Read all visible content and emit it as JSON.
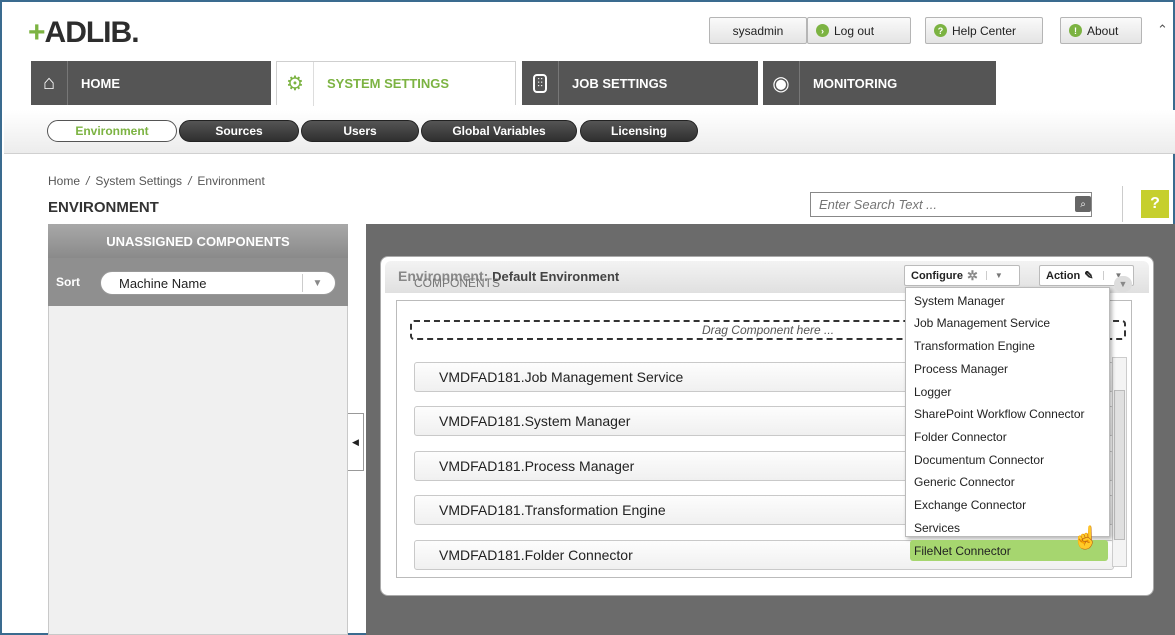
{
  "brand": {
    "logo_text": "ADLIB",
    "logo_mark": "+"
  },
  "topbar": {
    "user": "sysadmin",
    "logout_label": "Log out",
    "help_label": "Help Center",
    "about_label": "About"
  },
  "nav": {
    "home": "HOME",
    "system_settings": "SYSTEM SETTINGS",
    "job_settings": "JOB SETTINGS",
    "monitoring": "MONITORING"
  },
  "subnav": [
    "Environment",
    "Sources",
    "Users",
    "Global Variables",
    "Licensing"
  ],
  "breadcrumb": {
    "home": "Home",
    "sep": "/",
    "system_settings": "System Settings",
    "current": "Environment"
  },
  "page_title": "ENVIRONMENT",
  "search": {
    "placeholder": "Enter Search Text ..."
  },
  "help_mark": "?",
  "left_panel": {
    "title": "UNASSIGNED COMPONENTS",
    "sort_label": "Sort",
    "sort_value": "Machine Name"
  },
  "environment": {
    "label": "Environment:",
    "name": "Default Environment",
    "configure_label": "Configure",
    "action_label": "Action",
    "components_label": "COMPONENTS",
    "drop_hint": "Drag Component here ...",
    "items": [
      "VMDFAD181.Job Management Service",
      "VMDFAD181.System Manager",
      "VMDFAD181.Process Manager",
      "VMDFAD181.Transformation Engine",
      "VMDFAD181.Folder Connector"
    ]
  },
  "configure_menu": [
    "System Manager",
    "Job Management Service",
    "Transformation Engine",
    "Process Manager",
    "Logger",
    "SharePoint Workflow Connector",
    "Folder Connector",
    "Documentum Connector",
    "Generic Connector",
    "Exchange Connector",
    "Services",
    "FileNet Connector"
  ],
  "colors": {
    "brand_green": "#7cb342",
    "highlight": "#a6d66f",
    "nav_bg": "#555555"
  }
}
